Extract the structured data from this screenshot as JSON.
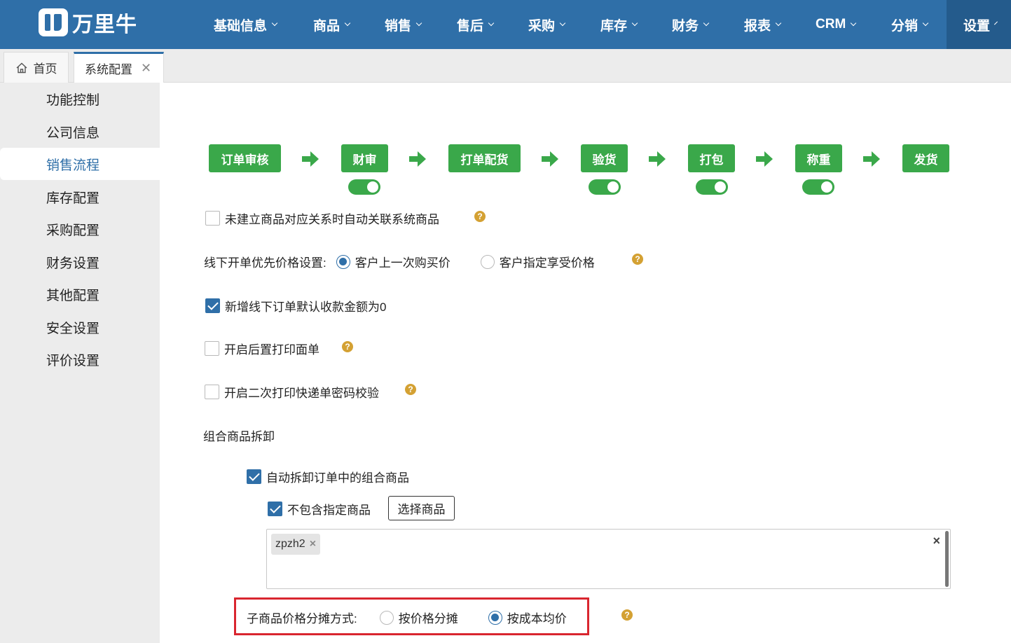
{
  "brand": {
    "name": "万里牛"
  },
  "nav": {
    "items": [
      {
        "label": "基础信息"
      },
      {
        "label": "商品"
      },
      {
        "label": "销售"
      },
      {
        "label": "售后"
      },
      {
        "label": "采购"
      },
      {
        "label": "库存"
      },
      {
        "label": "财务"
      },
      {
        "label": "报表"
      },
      {
        "label": "CRM"
      },
      {
        "label": "分销"
      },
      {
        "label": "设置"
      }
    ],
    "active": "设置"
  },
  "tabs": [
    {
      "label": "首页",
      "icon": "home-icon"
    },
    {
      "label": "系统配置",
      "closable": true
    }
  ],
  "sidebar": {
    "items": [
      {
        "label": "功能控制"
      },
      {
        "label": "公司信息"
      },
      {
        "label": "销售流程"
      },
      {
        "label": "库存配置"
      },
      {
        "label": "采购配置"
      },
      {
        "label": "财务设置"
      },
      {
        "label": "其他配置"
      },
      {
        "label": "安全设置"
      },
      {
        "label": "评价设置"
      }
    ],
    "active": "销售流程"
  },
  "flow": {
    "steps": [
      {
        "label": "订单审核",
        "toggle": null
      },
      {
        "label": "财审",
        "toggle": true
      },
      {
        "label": "打单配货",
        "toggle": null
      },
      {
        "label": "验货",
        "toggle": true
      },
      {
        "label": "打包",
        "toggle": true
      },
      {
        "label": "称重",
        "toggle": true
      },
      {
        "label": "发货",
        "toggle": null
      }
    ],
    "step_color": "#3aa84a"
  },
  "settings": {
    "auto_link": {
      "label": "未建立商品对应关系时自动关联系统商品",
      "checked": false
    },
    "price_priority": {
      "label": "线下开单优先价格设置:",
      "option1": "客户上一次购买价",
      "option2": "客户指定享受价格",
      "selected": "客户上一次购买价"
    },
    "default_zero": {
      "label": "新增线下订单默认收款金额为0",
      "checked": true
    },
    "post_print": {
      "label": "开启后置打印面单",
      "checked": false
    },
    "second_print": {
      "label": "开启二次打印快递单密码校验",
      "checked": false
    },
    "combo_section": {
      "title": "组合商品拆卸"
    },
    "auto_split": {
      "label": "自动拆卸订单中的组合商品",
      "checked": true
    },
    "exclude": {
      "label": "不包含指定商品",
      "checked": true,
      "button": "选择商品"
    },
    "selected_items": [
      "zpzh2"
    ],
    "allocation": {
      "label": "子商品价格分摊方式:",
      "option1": "按价格分摊",
      "option2": "按成本均价",
      "selected": "按成本均价"
    }
  },
  "colors": {
    "accent": "#2f6fa8",
    "nav_bg": "#2f6fa8",
    "highlight": "#d9262f",
    "help": "#d4a133"
  }
}
